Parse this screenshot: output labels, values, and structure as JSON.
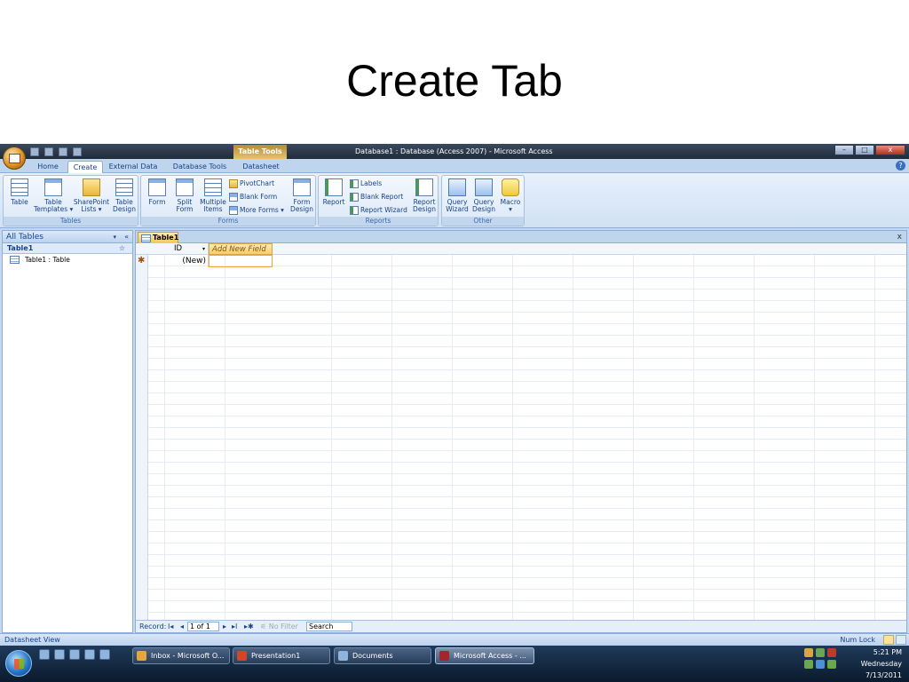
{
  "slide": {
    "title": "Create Tab"
  },
  "window": {
    "title": "Database1 : Database (Access 2007) - Microsoft Access",
    "context_tab": "Table Tools",
    "controls": {
      "minimize": "–",
      "maximize": "□",
      "close": "x"
    }
  },
  "ribbon_tabs": [
    "Home",
    "Create",
    "External Data",
    "Database Tools",
    "Datasheet"
  ],
  "active_tab": "Create",
  "help": "?",
  "ribbon": {
    "tables": {
      "label": "Tables",
      "buttons": [
        "Table",
        "Table\nTemplates ▾",
        "SharePoint\nLists ▾",
        "Table\nDesign"
      ]
    },
    "forms": {
      "label": "Forms",
      "buttons": [
        "Form",
        "Split\nForm",
        "Multiple\nItems",
        "Form\nDesign"
      ],
      "small": [
        "PivotChart",
        "Blank Form",
        "More Forms ▾"
      ]
    },
    "reports": {
      "label": "Reports",
      "buttons": [
        "Report",
        "Report\nDesign"
      ],
      "small": [
        "Labels",
        "Blank Report",
        "Report Wizard"
      ]
    },
    "other": {
      "label": "Other",
      "buttons": [
        "Query\nWizard",
        "Query\nDesign",
        "Macro\n▾"
      ]
    }
  },
  "nav": {
    "header": "All Tables",
    "dropdown": "▾",
    "collapse": "«",
    "group": "Table1",
    "group_toggle": "☆",
    "items": [
      "Table1 : Table"
    ]
  },
  "document": {
    "tab": "Table1",
    "close": "x",
    "columns": {
      "id": "ID",
      "add": "Add New Field"
    },
    "new_row": {
      "marker": "✱",
      "id": "(New)"
    }
  },
  "record_bar": {
    "label": "Record:",
    "first": "I◂",
    "prev": "◂",
    "position": "1 of 1",
    "next": "▸",
    "last": "▸I",
    "new": "▸✱",
    "filter": "No Filter",
    "search": "Search"
  },
  "status": {
    "left": "Datasheet View",
    "right": "Num Lock"
  },
  "taskbar": {
    "tasks": [
      "Inbox - Microsoft O...",
      "Presentation1",
      "Documents",
      "Microsoft Access - ..."
    ],
    "time": "5:21 PM",
    "day": "Wednesday",
    "date": "7/13/2011"
  }
}
